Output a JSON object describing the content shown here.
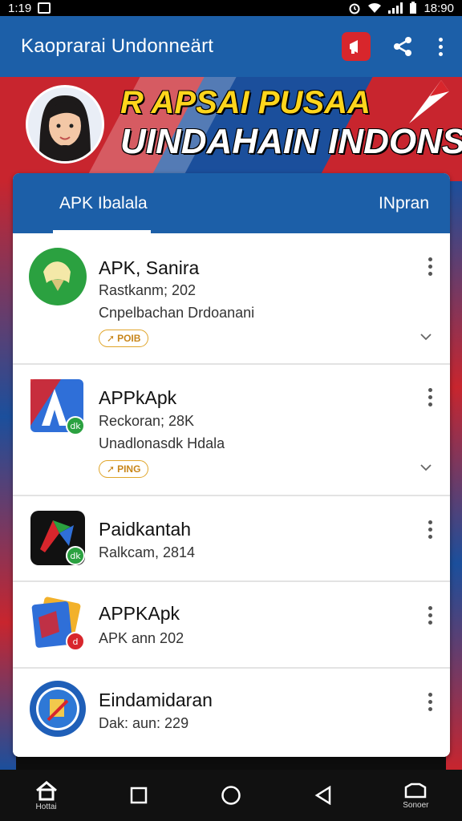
{
  "status_bar": {
    "time_left": "1:19",
    "time_right": "18:90"
  },
  "app_bar": {
    "title": "Kaoprarai Undonneärt"
  },
  "banner": {
    "line1": "R APSAI PUSAA",
    "line2": "UINDAHAIN INDONSA"
  },
  "tabs": [
    {
      "label": "APK Ibalala",
      "active": true
    },
    {
      "label": "INpran",
      "active": false
    }
  ],
  "apps": [
    {
      "name": "APK, Sanira",
      "meta1": "Rastkanm; 202",
      "meta2": "Cnpelbachan Drdoanani",
      "badge": "POIB"
    },
    {
      "name": "APPkApk",
      "meta1": "Reckoran; 28K",
      "meta2": "Unadlonasdk Hdala",
      "badge": "PING"
    },
    {
      "name": "Paidkantah",
      "meta1": "Ralkcam, 2814"
    },
    {
      "name": "APPKApk",
      "meta1": "APK ann 202"
    },
    {
      "name": "Eindamidaran",
      "meta1": "Dak: aun: 229"
    }
  ],
  "nav": {
    "home_label": "Hottai",
    "right_label": "Sonoer"
  },
  "colors": {
    "primary": "#1c5fa8",
    "accent_red": "#d8262c",
    "badge": "#e0a52a"
  }
}
